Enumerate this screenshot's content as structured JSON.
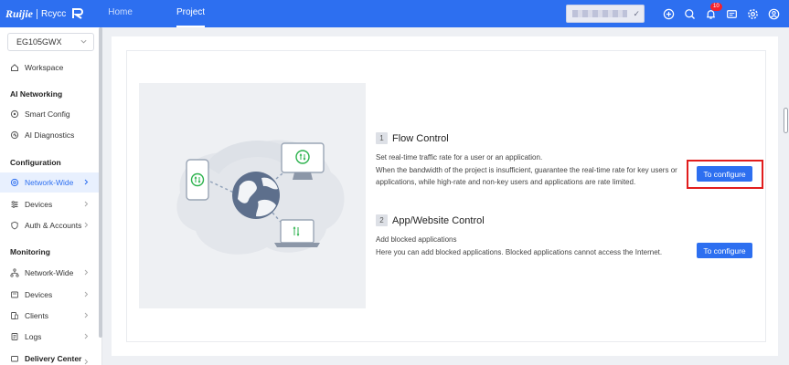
{
  "header": {
    "brand": "Ruijie",
    "product": "Rcycc",
    "nav": [
      {
        "label": "Home",
        "active": false
      },
      {
        "label": "Project",
        "active": true
      }
    ],
    "notification_count": "10",
    "icons": [
      "add-circle-icon",
      "search-icon",
      "bell-icon",
      "message-icon",
      "settings-icon",
      "user-icon"
    ]
  },
  "sidebar": {
    "device": "EG105GWX",
    "workspace": "Workspace",
    "groups": [
      {
        "title": "AI Networking",
        "items": [
          "Smart Config",
          "AI Diagnostics"
        ]
      },
      {
        "title": "Configuration",
        "items": [
          "Network-Wide",
          "Devices",
          "Auth & Accounts"
        ]
      },
      {
        "title": "Monitoring",
        "items": [
          "Network-Wide",
          "Devices",
          "Clients",
          "Logs"
        ]
      },
      {
        "title": "Delivery Center",
        "items": []
      }
    ],
    "active_item": "Configuration > Network-Wide"
  },
  "main": {
    "flow": {
      "number": "1",
      "title": "Flow Control",
      "line1": "Set real-time traffic rate for a user or an application.",
      "line2": "When the bandwidth of the project is insufficient, guarantee the real-time rate for key users or",
      "line3": "applications, while high-rate and non-key users and applications are rate limited.",
      "button": "To configure"
    },
    "app": {
      "number": "2",
      "title": "App/Website Control",
      "line1": "Add blocked applications",
      "line2": "Here you can add blocked applications. Blocked applications cannot access the Internet.",
      "button": "To configure"
    }
  },
  "colors": {
    "primary": "#2d6ff0",
    "highlight": "#e11d1d",
    "green": "#2bb24c"
  }
}
